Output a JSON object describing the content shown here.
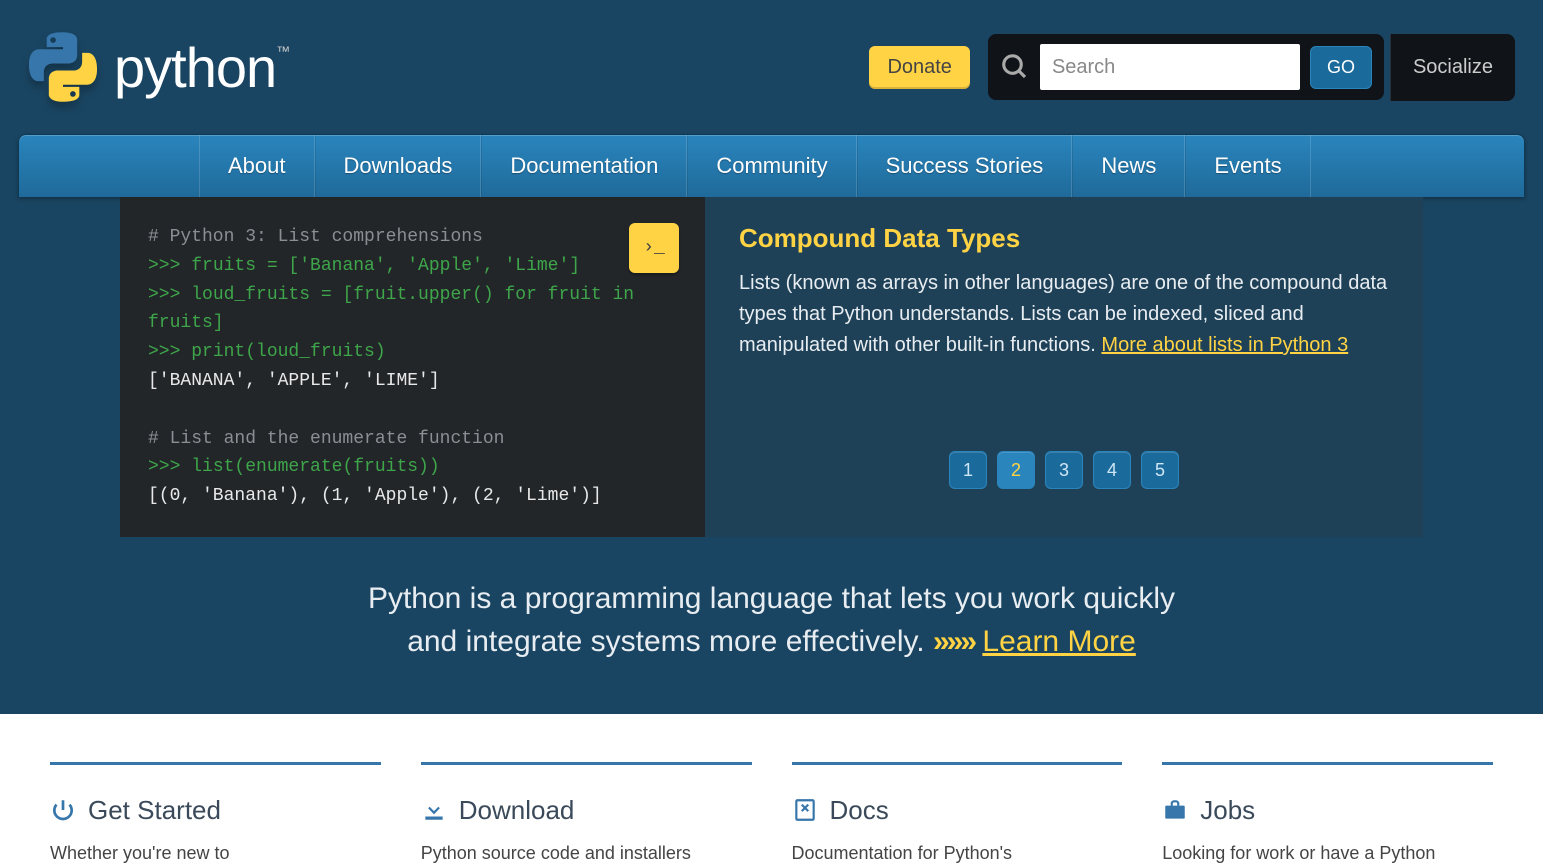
{
  "header": {
    "logo_text": "python",
    "logo_tm": "™",
    "donate": "Donate",
    "search_placeholder": "Search",
    "go": "GO",
    "socialize": "Socialize"
  },
  "nav": {
    "items": [
      "About",
      "Downloads",
      "Documentation",
      "Community",
      "Success Stories",
      "News",
      "Events"
    ]
  },
  "code": {
    "launch": "›_",
    "l1": "# Python 3: List comprehensions",
    "l2p": ">>> ",
    "l2": "fruits = ['Banana', 'Apple', 'Lime']",
    "l3p": ">>> ",
    "l3": "loud_fruits = [fruit.upper() for fruit in fruits]",
    "l4p": ">>> ",
    "l4": "print(loud_fruits)",
    "l5": "['BANANA', 'APPLE', 'LIME']",
    "l6": "# List and the enumerate function",
    "l7p": ">>> ",
    "l7": "list(enumerate(fruits))",
    "l8": "[(0, 'Banana'), (1, 'Apple'), (2, 'Lime')]"
  },
  "desc": {
    "title": "Compound Data Types",
    "text": "Lists (known as arrays in other languages) are one of the compound data types that Python understands. Lists can be indexed, sliced and manipulated with other built-in functions. ",
    "link": "More about lists in Python 3"
  },
  "pager": {
    "items": [
      "1",
      "2",
      "3",
      "4",
      "5"
    ],
    "active": 1
  },
  "tagline": {
    "line1": "Python is a programming language that lets you work quickly",
    "line2a": "and integrate systems more effectively. ",
    "chev": "﻿»»",
    "link": "Learn More"
  },
  "cols": {
    "c0": {
      "title": "Get Started",
      "text": "Whether you're new to"
    },
    "c1": {
      "title": "Download",
      "text": "Python source code and installers"
    },
    "c2": {
      "title": "Docs",
      "text": "Documentation for Python's"
    },
    "c3": {
      "title": "Jobs",
      "text": "Looking for work or have a Python"
    }
  }
}
